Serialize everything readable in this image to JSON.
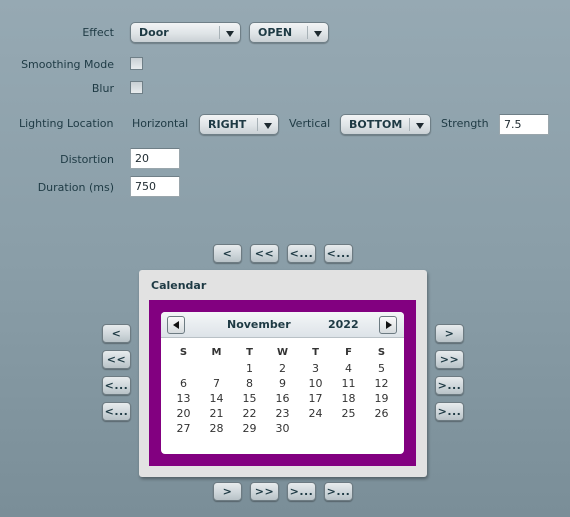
{
  "form": {
    "effect": {
      "label": "Effect",
      "type_value": "Door",
      "direction_value": "OPEN"
    },
    "smoothing_mode": {
      "label": "Smoothing Mode",
      "checked": false
    },
    "blur": {
      "label": "Blur",
      "checked": false
    },
    "lighting": {
      "label": "Lighting Location",
      "horizontal_label": "Horizontal",
      "horizontal_value": "RIGHT",
      "vertical_label": "Vertical",
      "vertical_value": "BOTTOM",
      "strength_label": "Strength",
      "strength_value": "7.5"
    },
    "distortion": {
      "label": "Distortion",
      "value": "20"
    },
    "duration": {
      "label": "Duration (ms)",
      "value": "750"
    }
  },
  "nav_top": [
    "<",
    "<<",
    "<...",
    "<..."
  ],
  "nav_left": [
    "<",
    "<<",
    "<...",
    "<..."
  ],
  "nav_right": [
    ">",
    ">>",
    ">...",
    ">..."
  ],
  "nav_bottom": [
    ">",
    ">>",
    ">...",
    ">..."
  ],
  "calendar": {
    "title": "Calendar",
    "month": "November",
    "year": "2022",
    "border_color": "#820080",
    "weekdays": [
      "S",
      "M",
      "T",
      "W",
      "T",
      "F",
      "S"
    ],
    "weeks": [
      [
        "",
        "",
        "1",
        "2",
        "3",
        "4",
        "5"
      ],
      [
        "6",
        "7",
        "8",
        "9",
        "10",
        "11",
        "12"
      ],
      [
        "13",
        "14",
        "15",
        "16",
        "17",
        "18",
        "19"
      ],
      [
        "20",
        "21",
        "22",
        "23",
        "24",
        "25",
        "26"
      ],
      [
        "27",
        "28",
        "29",
        "30",
        "",
        "",
        ""
      ]
    ]
  }
}
